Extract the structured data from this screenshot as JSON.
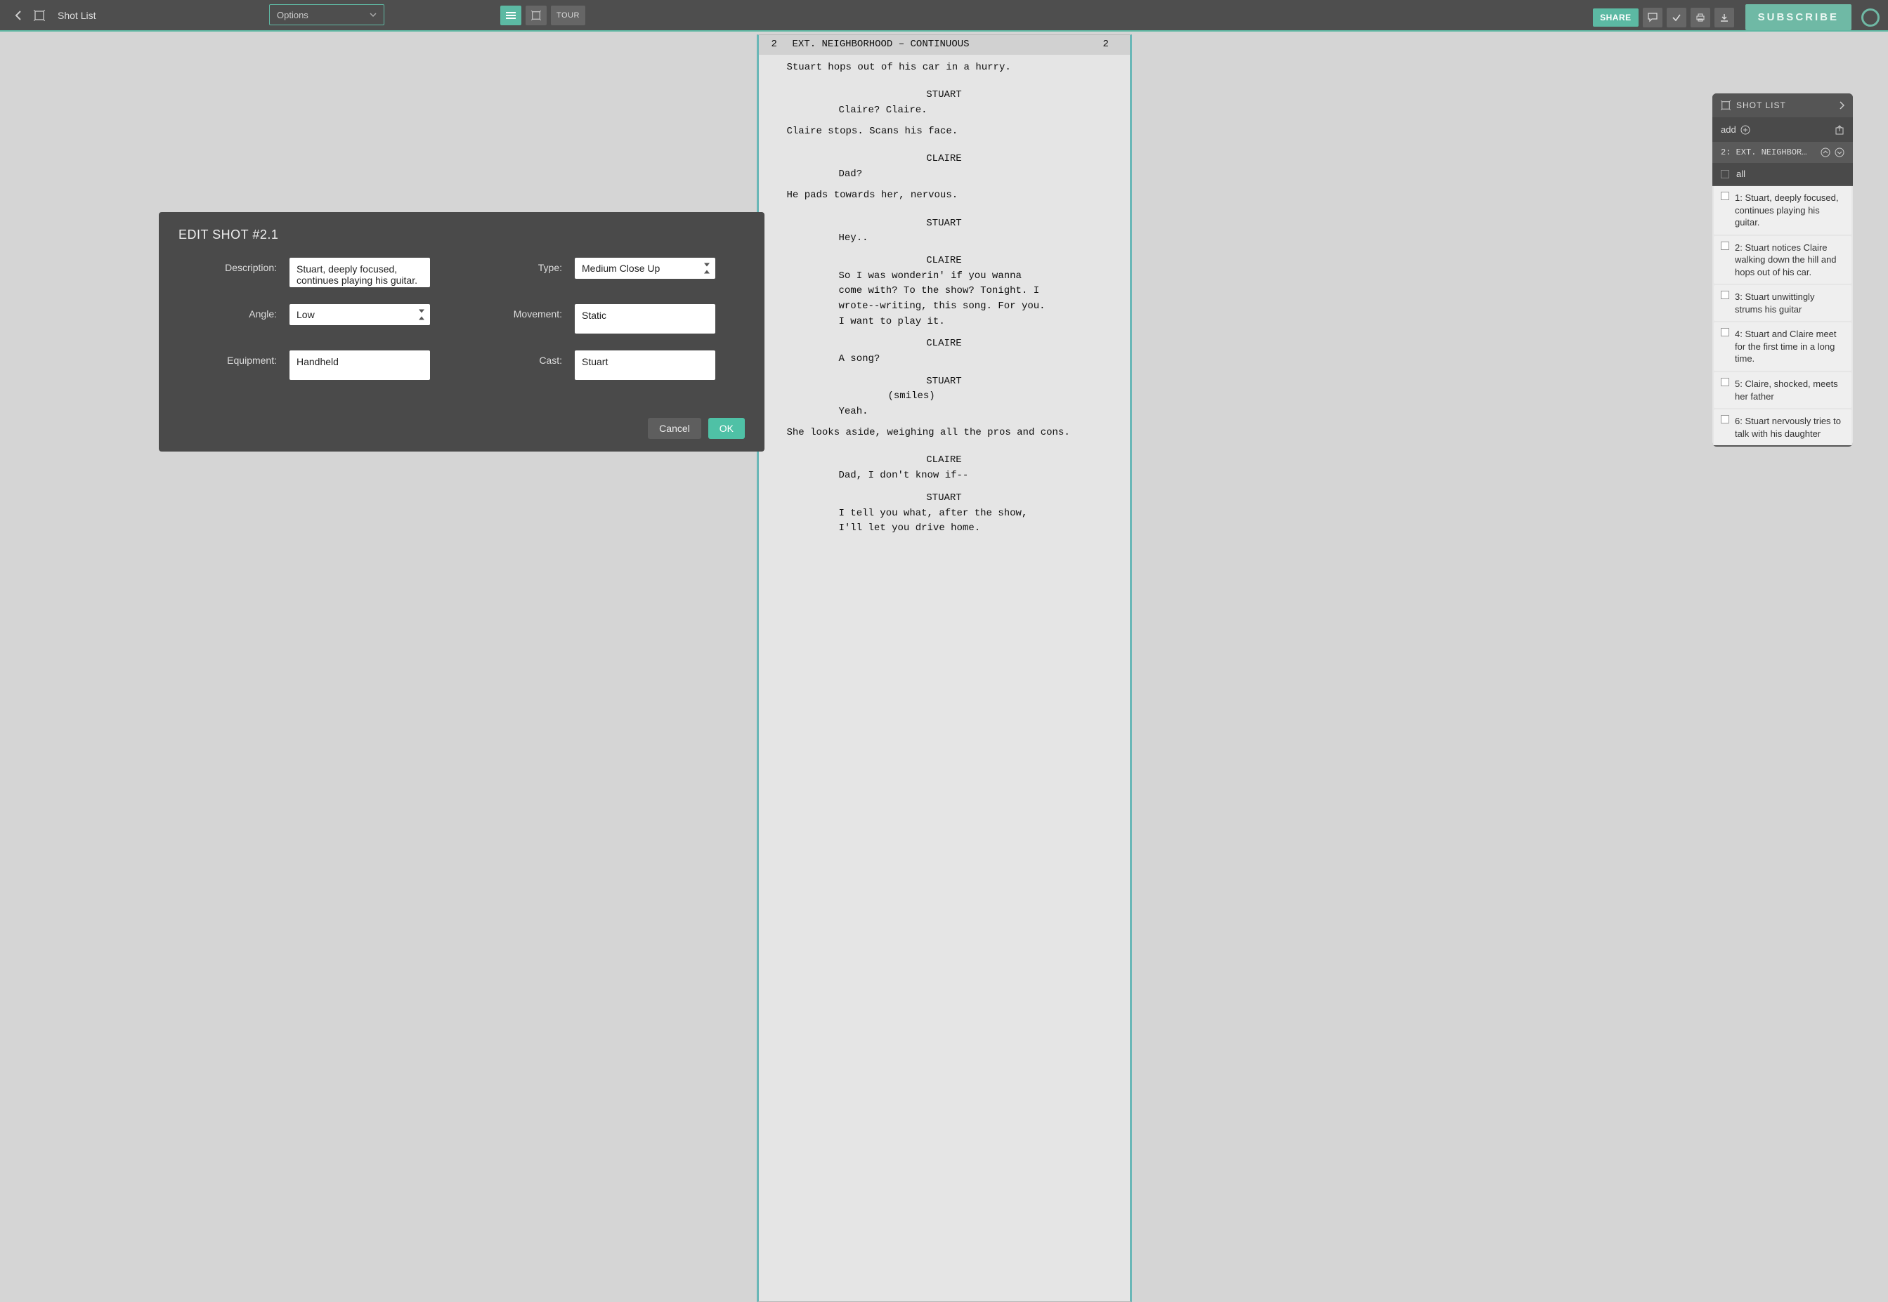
{
  "topbar": {
    "title": "Shot List",
    "options_label": "Options",
    "tour_label": "TOUR",
    "share_label": "SHARE",
    "subscribe_label": "SUBSCRIBE"
  },
  "script": {
    "scene_num_left": "2",
    "scene_num_right": "2",
    "slugline": "EXT. NEIGHBORHOOD – CONTINUOUS",
    "lines": [
      {
        "type": "action",
        "text": "Stuart hops out of his car in a hurry."
      },
      {
        "type": "cue",
        "text": "STUART"
      },
      {
        "type": "dialog",
        "text": "Claire? Claire."
      },
      {
        "type": "action",
        "text": "Claire stops. Scans his face."
      },
      {
        "type": "cue",
        "text": "CLAIRE"
      },
      {
        "type": "dialog",
        "text": "Dad?"
      },
      {
        "type": "action",
        "text": "He pads towards her, nervous."
      },
      {
        "type": "cue",
        "text": "STUART"
      },
      {
        "type": "dialog",
        "text": "Hey.."
      },
      {
        "type": "cue",
        "text": "CLAIRE"
      },
      {
        "type": "dialog",
        "text": "So I was wonderin' if you wanna come with? To the show? Tonight. I wrote--writing, this song. For you. I want to play it."
      },
      {
        "type": "cue",
        "text": "CLAIRE"
      },
      {
        "type": "dialog",
        "text": "A song?"
      },
      {
        "type": "cue",
        "text": "STUART"
      },
      {
        "type": "paren",
        "text": "(smiles)"
      },
      {
        "type": "dialog",
        "text": "Yeah."
      },
      {
        "type": "action",
        "text": "She looks aside, weighing all the pros and cons."
      },
      {
        "type": "cue",
        "text": "CLAIRE"
      },
      {
        "type": "dialog",
        "text": "Dad, I don't know if--"
      },
      {
        "type": "cue",
        "text": "STUART"
      },
      {
        "type": "dialog",
        "text": "I tell you what, after the show, I'll let you drive home."
      }
    ]
  },
  "side_panel": {
    "title": "SHOT LIST",
    "add_label": "add",
    "scene_label": "2: EXT. NEIGHBOR…",
    "all_label": "all",
    "items": [
      {
        "num": "1:",
        "text": "Stuart, deeply focused, continues playing his guitar."
      },
      {
        "num": "2:",
        "text": "Stuart notices Claire walking down the hill and hops out of his car."
      },
      {
        "num": "3:",
        "text": "Stuart unwittingly strums his guitar"
      },
      {
        "num": "4:",
        "text": "Stuart and Claire meet for the first time in a long time."
      },
      {
        "num": "5:",
        "text": "Claire, shocked, meets her father"
      },
      {
        "num": "6:",
        "text": "Stuart nervously tries to talk with his daughter"
      }
    ]
  },
  "modal": {
    "title": "EDIT SHOT #2.1",
    "labels": {
      "description": "Description:",
      "type": "Type:",
      "angle": "Angle:",
      "movement": "Movement:",
      "equipment": "Equipment:",
      "cast": "Cast:"
    },
    "values": {
      "description": "Stuart, deeply focused, continues playing his guitar.",
      "type": "Medium Close Up",
      "angle": "Low",
      "movement": "Static",
      "equipment": "Handheld",
      "cast": "Stuart"
    },
    "buttons": {
      "cancel": "Cancel",
      "ok": "OK"
    }
  }
}
